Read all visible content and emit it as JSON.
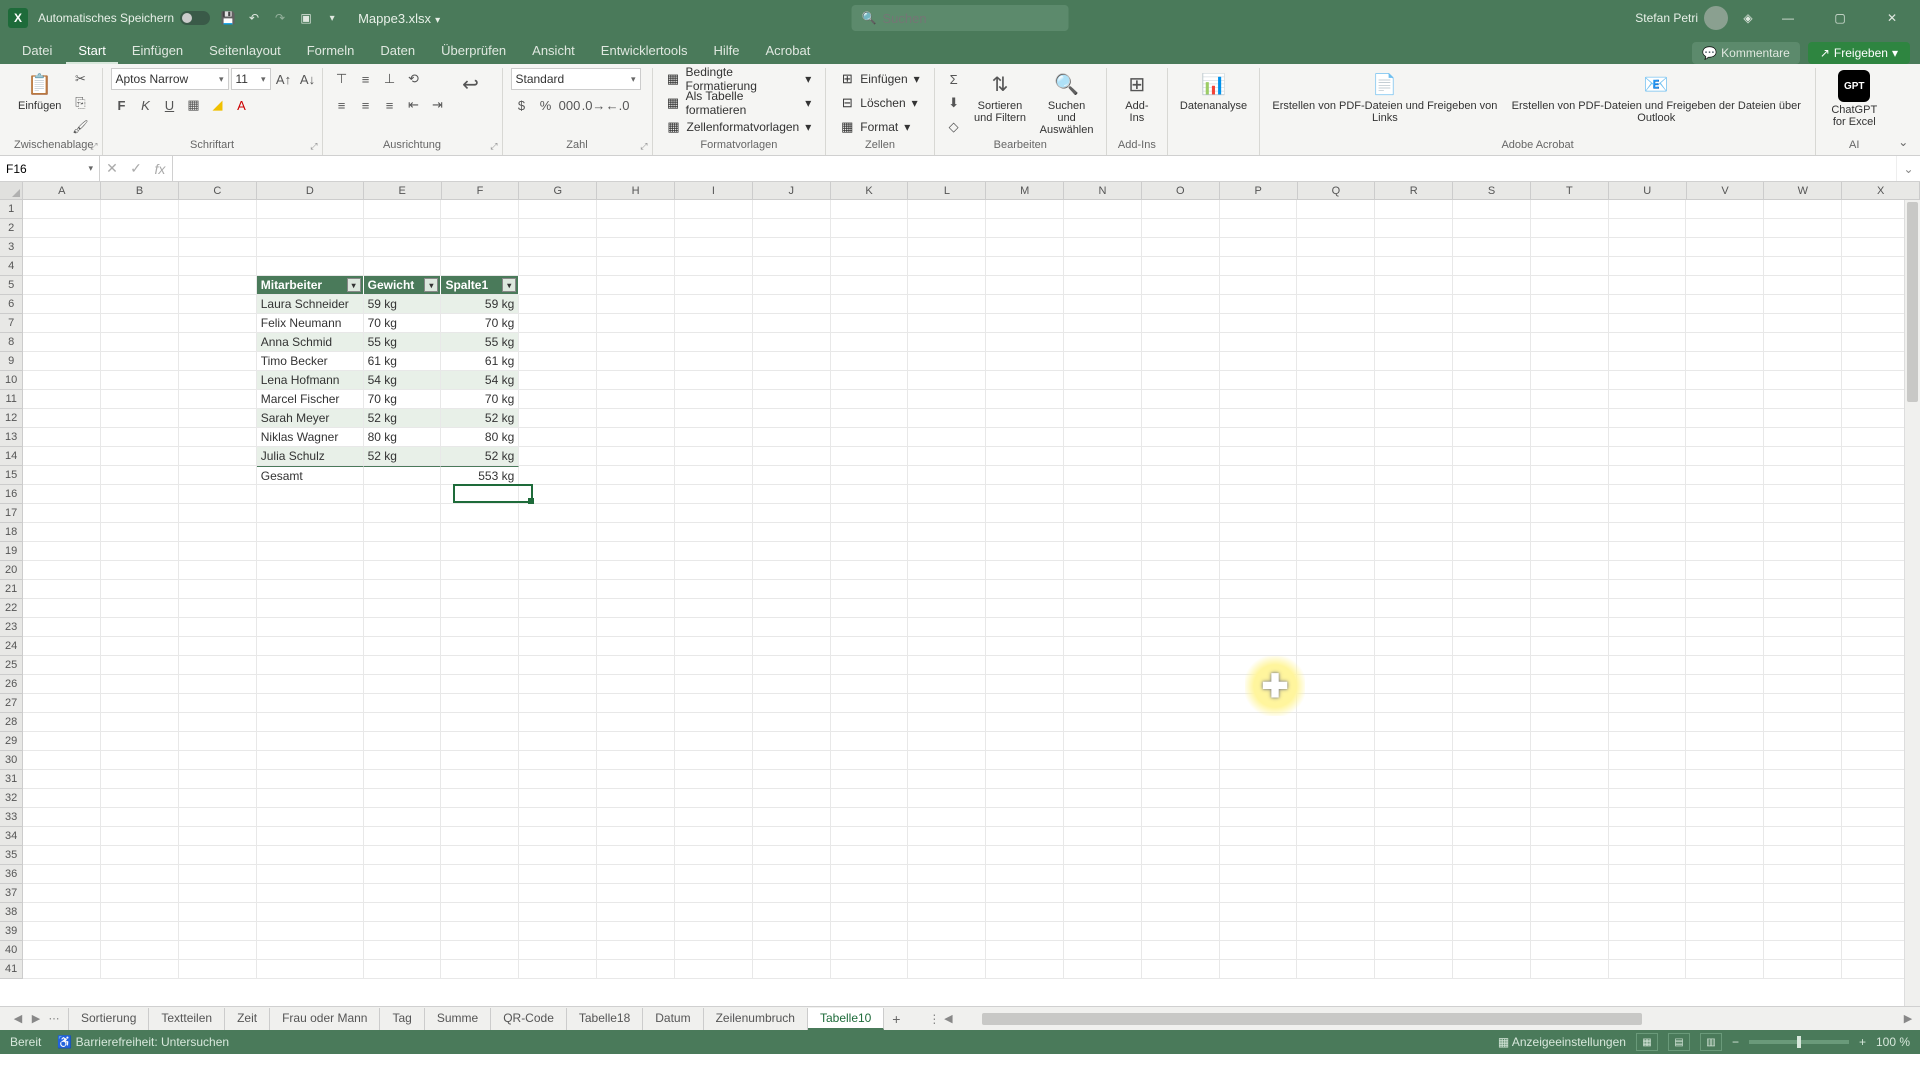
{
  "title": {
    "autosave": "Automatisches Speichern",
    "filename": "Mappe3.xlsx",
    "search_placeholder": "Suchen",
    "user": "Stefan Petri"
  },
  "winbtns": {
    "min": "—",
    "max": "▢",
    "close": "✕"
  },
  "menu": {
    "items": [
      "Datei",
      "Start",
      "Einfügen",
      "Seitenlayout",
      "Formeln",
      "Daten",
      "Überprüfen",
      "Ansicht",
      "Entwicklertools",
      "Hilfe",
      "Acrobat"
    ],
    "active": 1,
    "comments": "Kommentare",
    "share": "Freigeben"
  },
  "ribbon": {
    "paste": "Einfügen",
    "clipboard_label": "Zwischenablage",
    "font_name": "Aptos Narrow",
    "font_size": "11",
    "font_label": "Schriftart",
    "align_label": "Ausrichtung",
    "number_format": "Standard",
    "number_label": "Zahl",
    "cond_fmt": "Bedingte Formatierung",
    "as_table": "Als Tabelle formatieren",
    "cell_styles": "Zellenformatvorlagen",
    "styles_label": "Formatvorlagen",
    "insert": "Einfügen",
    "delete": "Löschen",
    "format": "Format",
    "cells_label": "Zellen",
    "sort_filter": "Sortieren und Filtern",
    "find_select": "Suchen und Auswählen",
    "edit_label": "Bearbeiten",
    "addins": "Add-Ins",
    "addins_label": "Add-Ins",
    "data_analysis": "Datenanalyse",
    "pdf_links": "Erstellen von PDF-Dateien und Freigeben von Links",
    "pdf_outlook": "Erstellen von PDF-Dateien und Freigeben der Dateien über Outlook",
    "acrobat_label": "Adobe Acrobat",
    "chatgpt": "ChatGPT for Excel",
    "gpt_badge": "GPT",
    "ai_label": "AI"
  },
  "formula": {
    "cell_ref": "F16",
    "value": ""
  },
  "columns": [
    "A",
    "B",
    "C",
    "D",
    "E",
    "F",
    "G",
    "H",
    "I",
    "J",
    "K",
    "L",
    "M",
    "N",
    "O",
    "P",
    "Q",
    "R",
    "S",
    "T",
    "U",
    "V",
    "W",
    "X"
  ],
  "col_widths": {
    "A": 80,
    "B": 80,
    "C": 80,
    "D": 110,
    "E": 80,
    "F": 80,
    "default": 80
  },
  "table": {
    "headers": [
      "Mitarbeiter",
      "Gewicht",
      "Spalte1"
    ],
    "rows": [
      {
        "name": "Laura Schneider",
        "w1": "59 kg",
        "w2": "59 kg"
      },
      {
        "name": "Felix Neumann",
        "w1": "70 kg",
        "w2": "70 kg"
      },
      {
        "name": "Anna Schmid",
        "w1": "55 kg",
        "w2": "55 kg"
      },
      {
        "name": "Timo Becker",
        "w1": "61 kg",
        "w2": "61 kg"
      },
      {
        "name": "Lena Hofmann",
        "w1": "54 kg",
        "w2": "54 kg"
      },
      {
        "name": "Marcel Fischer",
        "w1": "70 kg",
        "w2": "70 kg"
      },
      {
        "name": "Sarah Meyer",
        "w1": "52 kg",
        "w2": "52 kg"
      },
      {
        "name": "Niklas Wagner",
        "w1": "80 kg",
        "w2": "80 kg"
      },
      {
        "name": "Julia Schulz",
        "w1": "52 kg",
        "w2": "52 kg"
      }
    ],
    "total_label": "Gesamt",
    "total_value": "553 kg"
  },
  "sheets": {
    "tabs": [
      "Sortierung",
      "Textteilen",
      "Zeit",
      "Frau oder Mann",
      "Tag",
      "Summe",
      "QR-Code",
      "Tabelle18",
      "Datum",
      "Zeilenumbruch",
      "Tabelle10"
    ],
    "active": 10
  },
  "status": {
    "ready": "Bereit",
    "access": "Barrierefreiheit: Untersuchen",
    "display": "Anzeigeeinstellungen",
    "zoom": "100 %"
  }
}
